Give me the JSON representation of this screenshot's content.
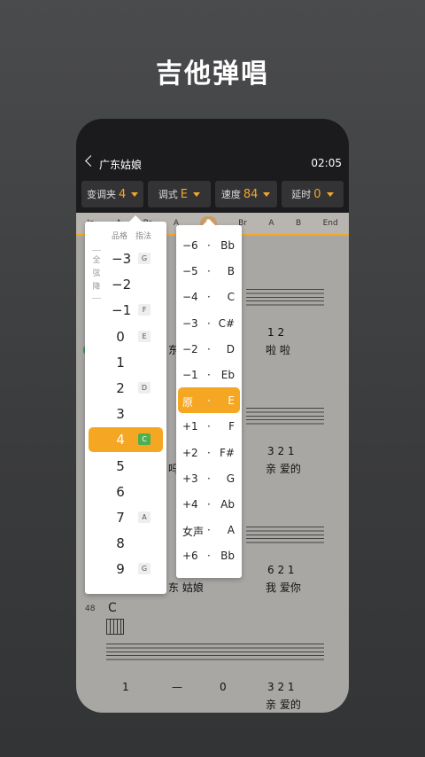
{
  "promo": {
    "title": "吉他弹唱"
  },
  "header": {
    "back_icon": "chevron-left-icon",
    "song_title": "广东姑娘",
    "time": "02:05"
  },
  "controls": [
    {
      "label": "变调夹",
      "value": "4"
    },
    {
      "label": "调式",
      "value": "E"
    },
    {
      "label": "速度",
      "value": "84"
    },
    {
      "label": "延时",
      "value": "0"
    }
  ],
  "sections": [
    "In",
    "A",
    "Br",
    "A",
    "B",
    "Br",
    "A",
    "B",
    "End"
  ],
  "capo": {
    "header_fret": "品格",
    "header_shape": "指法",
    "side_label": "全弦降",
    "rows": [
      {
        "fret": "−3",
        "shape": "G"
      },
      {
        "fret": "−2",
        "shape": ""
      },
      {
        "fret": "−1",
        "shape": "F"
      },
      {
        "fret": "0",
        "shape": "E"
      },
      {
        "fret": "1",
        "shape": ""
      },
      {
        "fret": "2",
        "shape": "D"
      },
      {
        "fret": "3",
        "shape": ""
      },
      {
        "fret": "4",
        "shape": "C",
        "selected": true
      },
      {
        "fret": "5",
        "shape": ""
      },
      {
        "fret": "6",
        "shape": ""
      },
      {
        "fret": "7",
        "shape": "A"
      },
      {
        "fret": "8",
        "shape": ""
      },
      {
        "fret": "9",
        "shape": "G"
      }
    ]
  },
  "key": {
    "rows": [
      {
        "shift": "−6",
        "dot": "·",
        "key": "Bb"
      },
      {
        "shift": "−5",
        "dot": "·",
        "key": "B"
      },
      {
        "shift": "−4",
        "dot": "·",
        "key": "C"
      },
      {
        "shift": "−3",
        "dot": "·",
        "key": "C#"
      },
      {
        "shift": "−2",
        "dot": "·",
        "key": "D"
      },
      {
        "shift": "−1",
        "dot": "·",
        "key": "Eb"
      },
      {
        "shift": "原",
        "dot": "·",
        "key": "E",
        "selected": true
      },
      {
        "shift": "+1",
        "dot": "·",
        "key": "F"
      },
      {
        "shift": "+2",
        "dot": "·",
        "key": "F#"
      },
      {
        "shift": "+3",
        "dot": "·",
        "key": "G"
      },
      {
        "shift": "+4",
        "dot": "·",
        "key": "Ab"
      },
      {
        "shift": "女声",
        "dot": "·",
        "key": "A"
      },
      {
        "shift": "+6",
        "dot": "·",
        "key": "Bb"
      }
    ]
  },
  "sheet": {
    "line1": {
      "nums": "1  2",
      "lyrics_left": "东",
      "lyrics_right": "啦    啦"
    },
    "line2": {
      "nums": "3  2 1",
      "lyrics_left": "吗",
      "lyrics_right": "亲    爱的"
    },
    "line3": {
      "nums": "6  2 1",
      "lyrics_left": "东    姑娘",
      "lyrics_right": "我    爱你"
    },
    "line4": {
      "bar_number": "48",
      "chord": "C",
      "nums_a": "1",
      "nums_b": "—",
      "nums_c": "0",
      "nums_d": "3  2 1",
      "lyrics_right": "亲    爱的"
    }
  }
}
